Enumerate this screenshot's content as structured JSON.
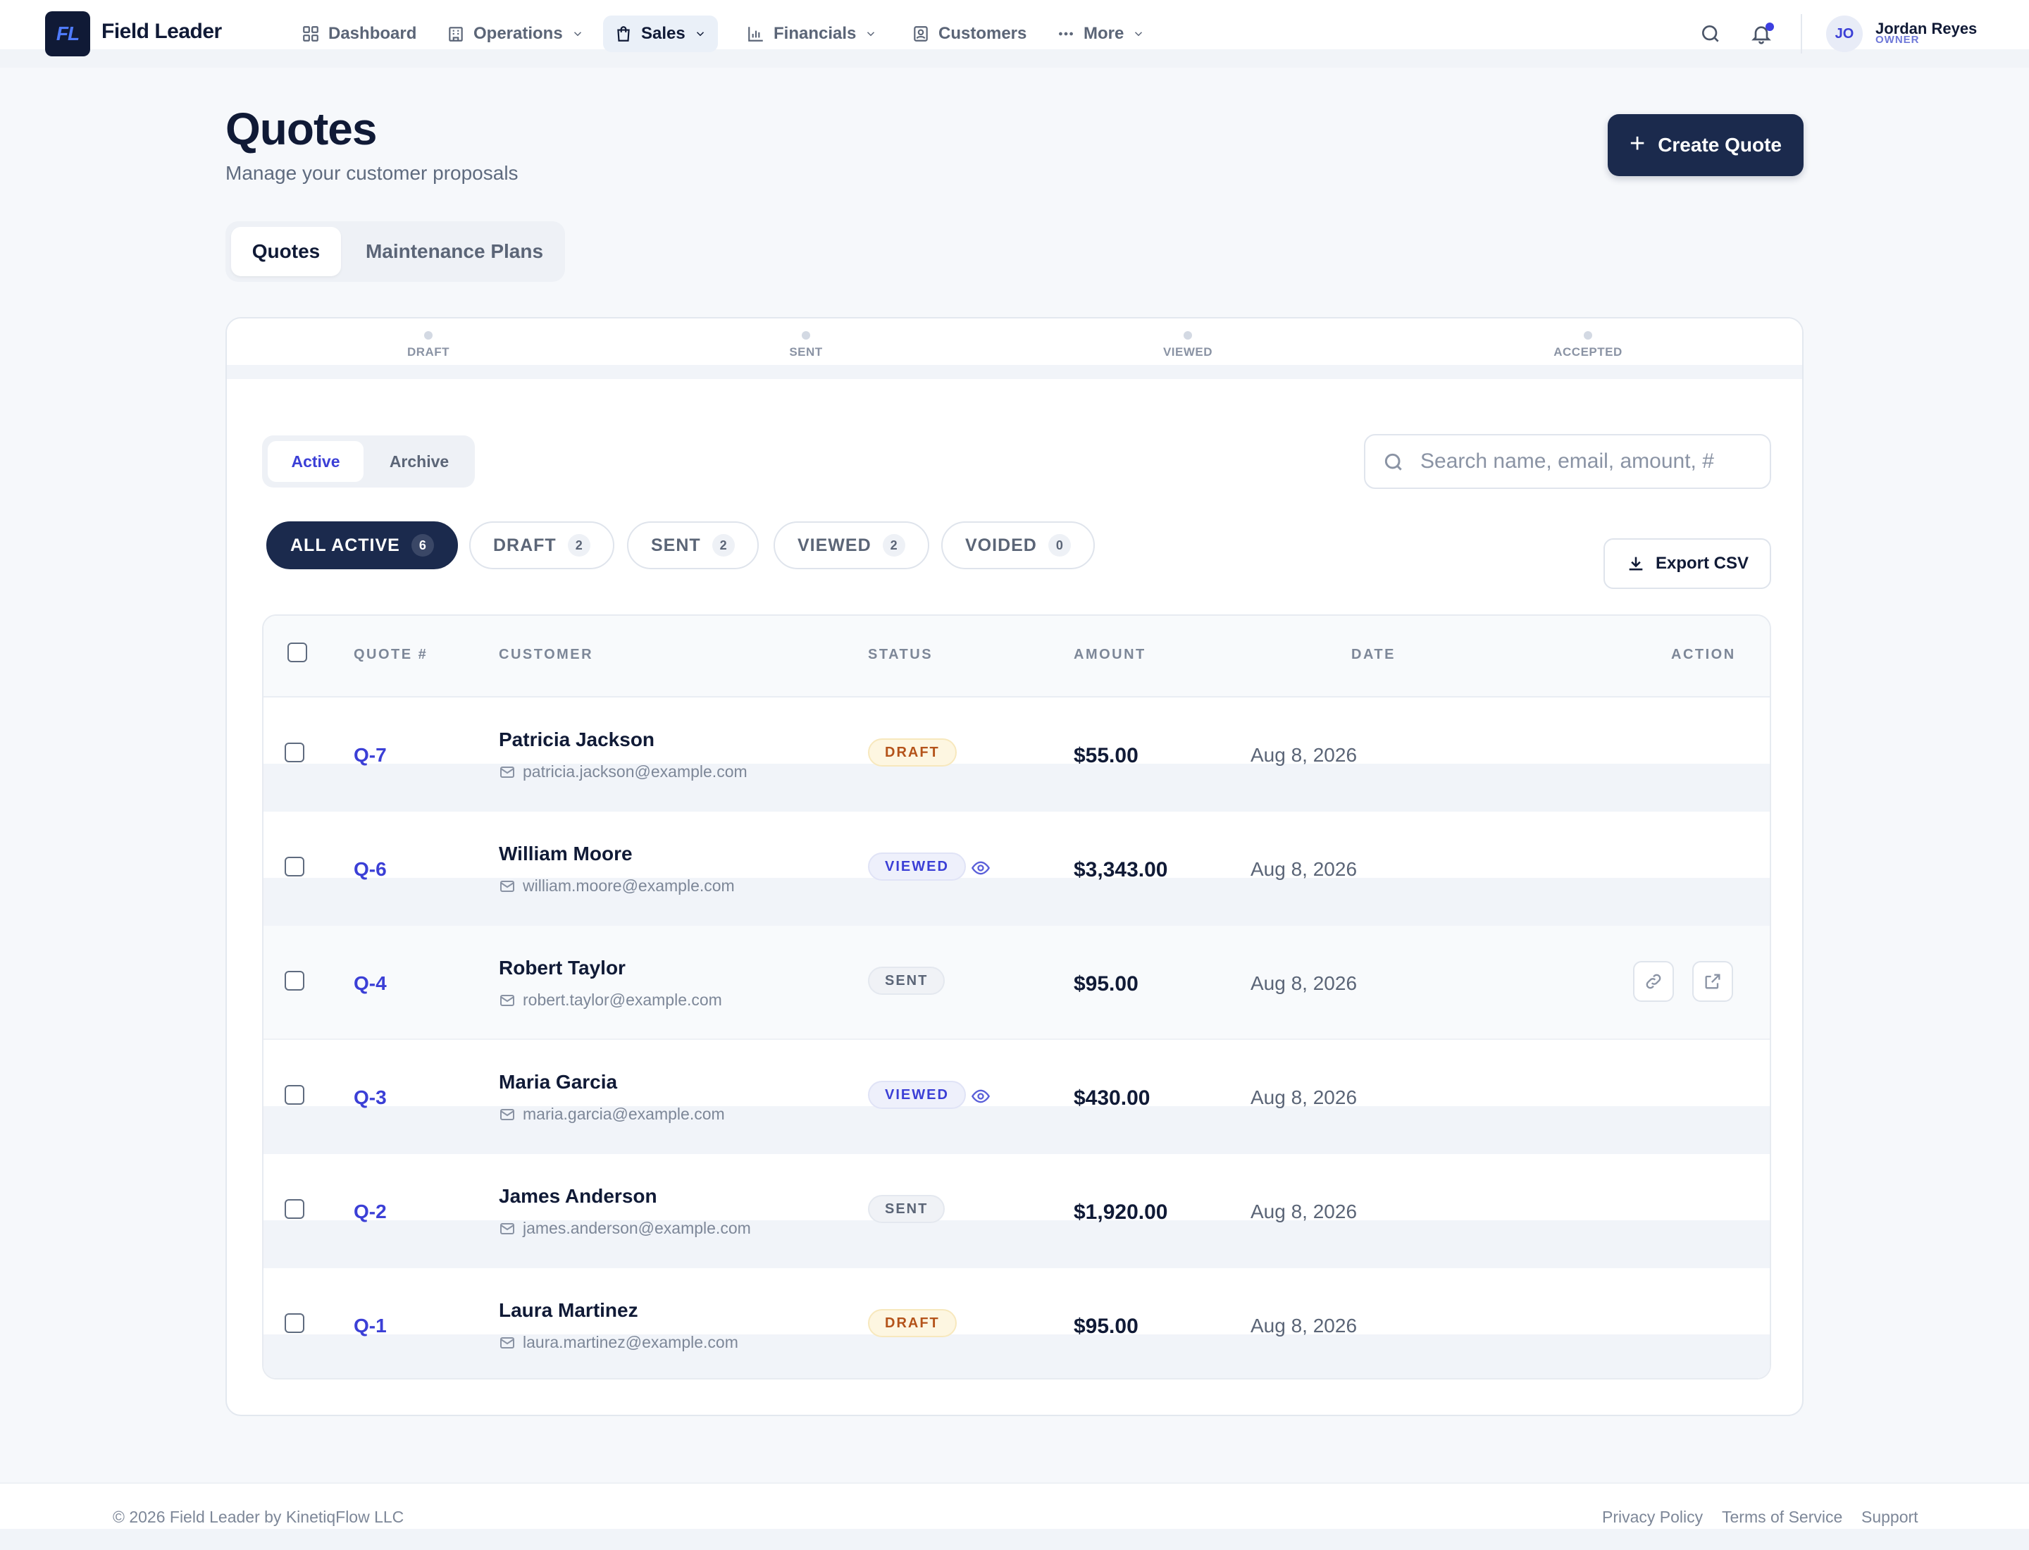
{
  "app": {
    "logo_text": "FL",
    "name": "Field Leader"
  },
  "nav": {
    "items": [
      {
        "label": "Dashboard",
        "icon": "dashboard-icon"
      },
      {
        "label": "Operations",
        "icon": "building-icon"
      },
      {
        "label": "Sales",
        "icon": "shopping-bag-icon",
        "active": true
      },
      {
        "label": "Financials",
        "icon": "bar-chart-icon"
      },
      {
        "label": "Customers",
        "icon": "contact-icon"
      },
      {
        "label": "More",
        "icon": "more-dots-icon"
      }
    ]
  },
  "user": {
    "initials": "JO",
    "name": "Jordan Reyes",
    "role": "OWNER"
  },
  "page": {
    "title": "Quotes",
    "subtitle": "Manage your customer proposals",
    "create_label": "Create Quote"
  },
  "tabs": {
    "quotes": "Quotes",
    "plans": "Maintenance Plans"
  },
  "stepper": [
    "DRAFT",
    "SENT",
    "VIEWED",
    "ACCEPTED"
  ],
  "segment": {
    "active": "Active",
    "archive": "Archive"
  },
  "search": {
    "placeholder": "Search name, email, amount, #"
  },
  "filters": [
    {
      "label": "ALL ACTIVE",
      "count": "6"
    },
    {
      "label": "DRAFT",
      "count": "2"
    },
    {
      "label": "SENT",
      "count": "2"
    },
    {
      "label": "VIEWED",
      "count": "2"
    },
    {
      "label": "VOIDED",
      "count": "0"
    }
  ],
  "export_label": "Export CSV",
  "table": {
    "headers": {
      "quote": "QUOTE #",
      "customer": "CUSTOMER",
      "status": "STATUS",
      "amount": "AMOUNT",
      "date": "DATE",
      "action": "ACTION"
    },
    "rows": [
      {
        "quote": "Q-7",
        "name": "Patricia Jackson",
        "email": "patricia.jackson@example.com",
        "status": "DRAFT",
        "amount": "$55.00",
        "date": "Aug 8, 2026"
      },
      {
        "quote": "Q-6",
        "name": "William Moore",
        "email": "william.moore@example.com",
        "status": "VIEWED",
        "amount": "$3,343.00",
        "date": "Aug 8, 2026"
      },
      {
        "quote": "Q-4",
        "name": "Robert Taylor",
        "email": "robert.taylor@example.com",
        "status": "SENT",
        "amount": "$95.00",
        "date": "Aug 8, 2026"
      },
      {
        "quote": "Q-3",
        "name": "Maria Garcia",
        "email": "maria.garcia@example.com",
        "status": "VIEWED",
        "amount": "$430.00",
        "date": "Aug 8, 2026"
      },
      {
        "quote": "Q-2",
        "name": "James Anderson",
        "email": "james.anderson@example.com",
        "status": "SENT",
        "amount": "$1,920.00",
        "date": "Aug 8, 2026"
      },
      {
        "quote": "Q-1",
        "name": "Laura Martinez",
        "email": "laura.martinez@example.com",
        "status": "DRAFT",
        "amount": "$95.00",
        "date": "Aug 8, 2026"
      }
    ]
  },
  "footer": {
    "copyright": "© 2026 Field Leader by KinetiqFlow LLC",
    "links": [
      "Privacy Policy",
      "Terms of Service",
      "Support"
    ]
  },
  "colors": {
    "primary": "#1b2a4d",
    "accent": "#3b3fd6",
    "draft": "#b4531a"
  }
}
